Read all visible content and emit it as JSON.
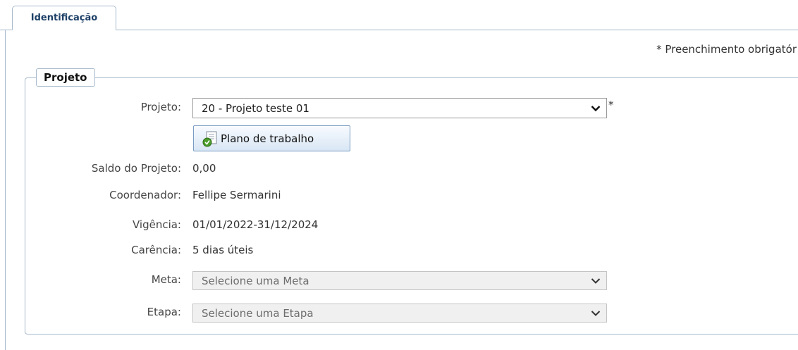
{
  "tabs": [
    {
      "label": "Identificação",
      "active": true
    }
  ],
  "required_note": "* Preenchimento obrigatór",
  "section": {
    "legend": "Projeto"
  },
  "form": {
    "projeto": {
      "label": "Projeto:",
      "value": "20 - Projeto teste 01",
      "required_mark": "*"
    },
    "plano_button": {
      "label": "Plano de trabalho",
      "icon": "document-check-icon"
    },
    "saldo": {
      "label": "Saldo do Projeto:",
      "value": "0,00"
    },
    "coordenador": {
      "label": "Coordenador:",
      "value": "Fellipe Sermarini"
    },
    "vigencia": {
      "label": "Vigência:",
      "value": "01/01/2022-31/12/2024"
    },
    "carencia": {
      "label": "Carência:",
      "value": "5 dias úteis"
    },
    "meta": {
      "label": "Meta:",
      "placeholder": "Selecione uma Meta",
      "disabled": true
    },
    "etapa": {
      "label": "Etapa:",
      "placeholder": "Selecione uma Etapa",
      "disabled": true
    }
  },
  "colors": {
    "border": "#a6b9cc",
    "tab_text": "#1d3f66",
    "button_gradient_bottom": "#d8e6f4"
  }
}
